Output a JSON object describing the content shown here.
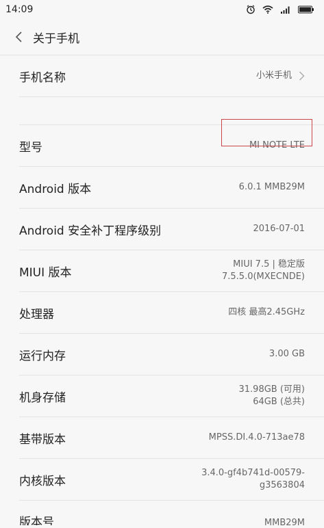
{
  "status": {
    "time": "14:09",
    "icons": [
      "alarm-icon",
      "wifi-icon",
      "signal-icon",
      "battery-icon"
    ]
  },
  "header": {
    "back_icon": "chevron-left-icon",
    "title": "关于手机"
  },
  "rows": {
    "phone_name": {
      "label": "手机名称",
      "value": "小米手机"
    },
    "model": {
      "label": "型号",
      "value": "MI NOTE LTE"
    },
    "android_version": {
      "label": "Android 版本",
      "value": "6.0.1 MMB29M"
    },
    "security_patch": {
      "label": "Android 安全补丁程序级别",
      "value": "2016-07-01"
    },
    "miui_version": {
      "label": "MIUI 版本",
      "value_line1": "MIUI 7.5 | 稳定版",
      "value_line2": "7.5.5.0(MXECNDE)"
    },
    "processor": {
      "label": "处理器",
      "value": "四核 最高2.45GHz"
    },
    "ram": {
      "label": "运行内存",
      "value": "3.00 GB"
    },
    "storage": {
      "label": "机身存储",
      "value_line1": "31.98GB (可用)",
      "value_line2": "64GB (总共)"
    },
    "baseband": {
      "label": "基带版本",
      "value": "MPSS.DI.4.0-713ae78"
    },
    "kernel": {
      "label": "内核版本",
      "value_line1": "3.4.0-gf4b741d-00579-",
      "value_line2": "g3563804"
    },
    "build": {
      "label": "版本号",
      "value": "MMB29M"
    }
  },
  "colors": {
    "highlight_border": "#c9454a",
    "background": "#f7f7f7"
  }
}
